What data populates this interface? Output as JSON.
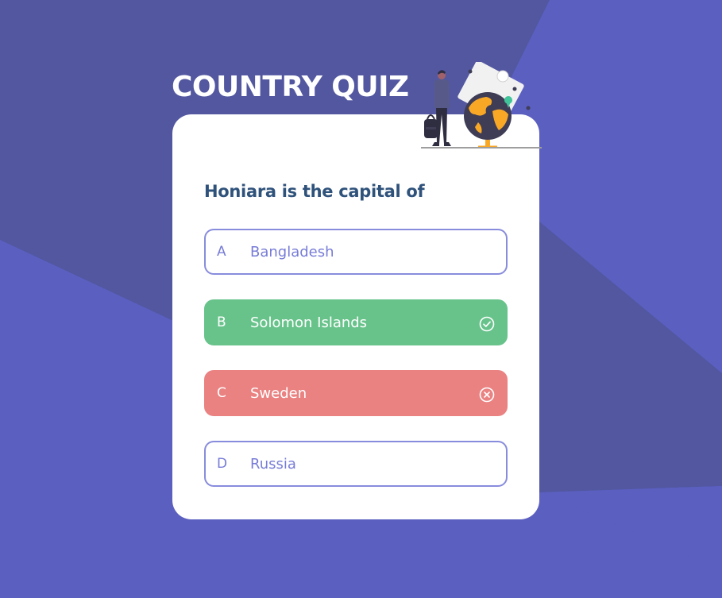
{
  "app": {
    "title": "COUNTRY QUIZ"
  },
  "quiz": {
    "question": "Honiara is the capital of",
    "options": [
      {
        "letter": "A",
        "label": "Bangladesh",
        "state": "default"
      },
      {
        "letter": "B",
        "label": "Solomon Islands",
        "state": "correct",
        "icon": "check-circle-icon"
      },
      {
        "letter": "C",
        "label": "Sweden",
        "state": "wrong",
        "icon": "x-circle-icon"
      },
      {
        "letter": "D",
        "label": "Russia",
        "state": "default"
      }
    ]
  },
  "colors": {
    "background": "#5b5fc0",
    "background_shape": "#5257a0",
    "card": "#ffffff",
    "question_text": "#2f527b",
    "option_accent": "#6066d0",
    "correct": "#68c38b",
    "wrong": "#ea8282"
  }
}
